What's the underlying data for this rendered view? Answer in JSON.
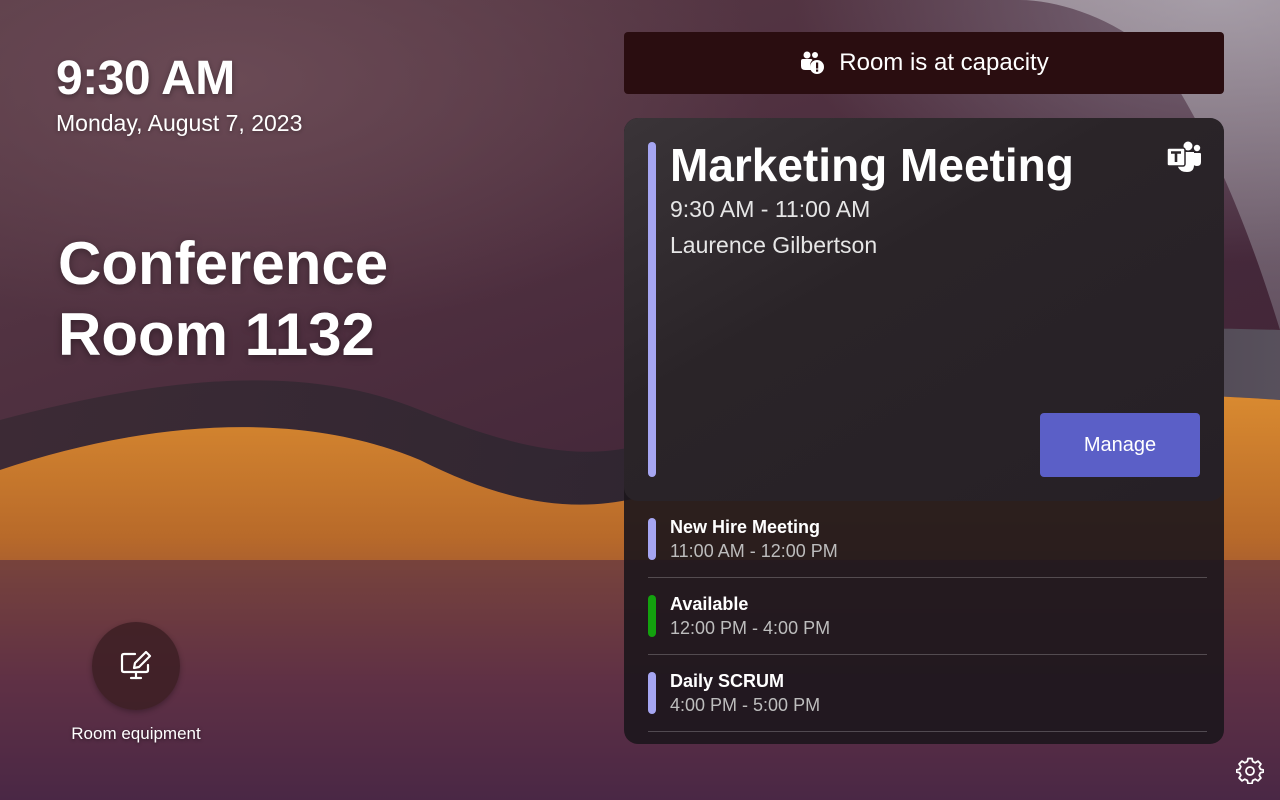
{
  "clock": {
    "time": "9:30 AM",
    "date": "Monday, August 7, 2023"
  },
  "room": {
    "name": "Conference Room 1132"
  },
  "equipment": {
    "label": "Room equipment",
    "icon": "monitor-edit-icon"
  },
  "capacity": {
    "text": "Room is at capacity",
    "icon": "people-alert-icon",
    "color": "#2a0d10"
  },
  "current_meeting": {
    "title": "Marketing Meeting",
    "time": "9:30 AM - 11:00 AM",
    "organizer": "Laurence Gilbertson",
    "accent_color": "#a6a6f2",
    "app_icon": "teams-icon",
    "manage_label": "Manage",
    "manage_color": "#5b5fc7"
  },
  "upcoming": [
    {
      "title": "New Hire Meeting",
      "time": "11:00 AM - 12:00 PM",
      "color": "#a6a6f2"
    },
    {
      "title": "Available",
      "time": "12:00 PM - 4:00 PM",
      "color": "#13a10e"
    },
    {
      "title": "Daily SCRUM",
      "time": "4:00 PM - 5:00 PM",
      "color": "#a6a6f2"
    }
  ],
  "settings": {
    "icon": "gear-icon"
  }
}
